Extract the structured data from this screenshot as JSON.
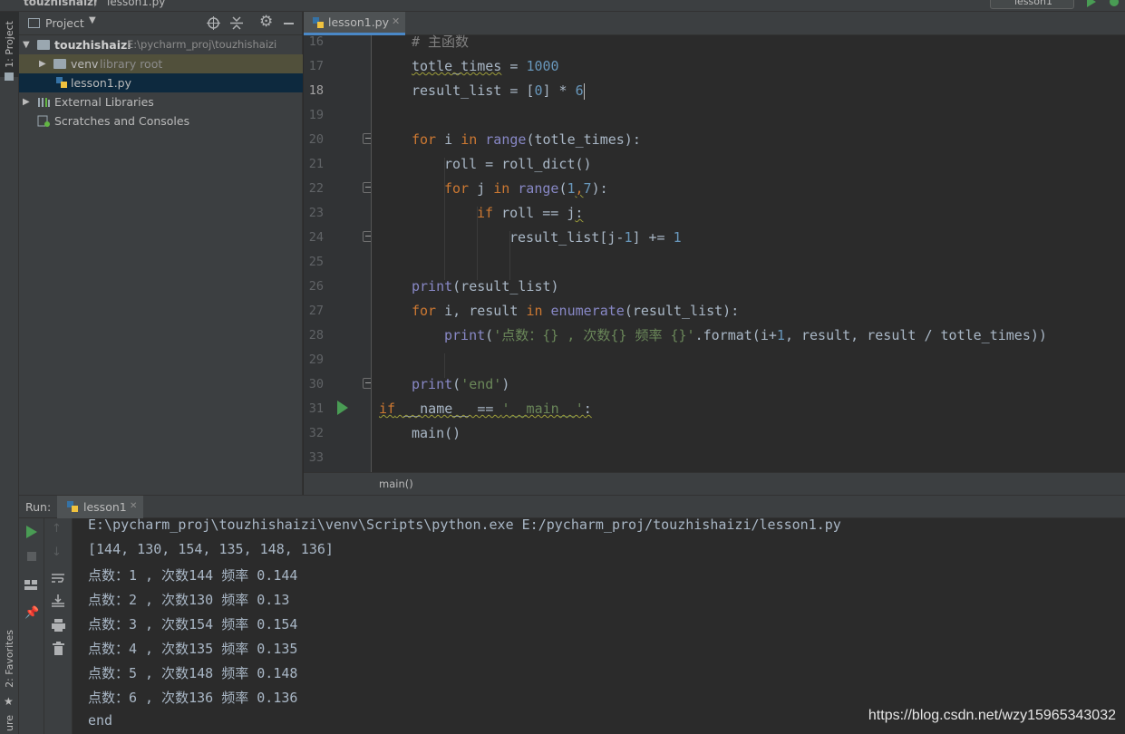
{
  "titlebar": {
    "project": "touzhishaizi",
    "file": "lesson1.py",
    "run_config": "lesson1"
  },
  "side_tabs": {
    "project": "1: Project",
    "favorites": "2: Favorites",
    "structure": "ure"
  },
  "project_panel": {
    "header": "Project",
    "tree": [
      {
        "label": "touzhishaizi",
        "extra": "E:\\pycharm_proj\\touzhishaizi",
        "icon": "folder-icon"
      },
      {
        "label": "venv",
        "extra": "library root",
        "icon": "folder-icon"
      },
      {
        "label": "lesson1.py",
        "extra": "",
        "icon": "python-file-icon"
      },
      {
        "label": "External Libraries",
        "extra": "",
        "icon": "library-icon"
      },
      {
        "label": "Scratches and Consoles",
        "extra": "",
        "icon": "scratches-icon"
      }
    ]
  },
  "editor": {
    "tab_label": "lesson1.py",
    "breadcrumb": "main()",
    "line_numbers": [
      "16",
      "17",
      "18",
      "19",
      "20",
      "21",
      "22",
      "23",
      "24",
      "25",
      "26",
      "27",
      "28",
      "29",
      "30",
      "31",
      "32",
      "33"
    ],
    "code": {
      "l16": "# 主函数",
      "l17a": "totle_times",
      "l17b": " = ",
      "l17c": "1000",
      "l18a": "result_list = [",
      "l18b": "0",
      "l18c": "] * ",
      "l18d": "6",
      "l20a": "for",
      "l20b": " i ",
      "l20c": "in",
      "l20d": " ",
      "l20e": "range",
      "l20f": "(totle_times):",
      "l21": "roll = roll_dict()",
      "l22a": "for",
      "l22b": " j ",
      "l22c": "in",
      "l22d": " ",
      "l22e": "range",
      "l22f": "(",
      "l22g": "1",
      "l22h": ",",
      "l22i": "7",
      "l22j": "):",
      "l23a": "if",
      "l23b": " roll == j",
      "l23c": ":",
      "l24a": "result_list[j-",
      "l24b": "1",
      "l24c": "] += ",
      "l24d": "1",
      "l26a": "print",
      "l26b": "(result_list)",
      "l27a": "for",
      "l27b": " i, result ",
      "l27c": "in",
      "l27d": " ",
      "l27e": "enumerate",
      "l27f": "(result_list):",
      "l28a": "print",
      "l28b": "(",
      "l28c": "'点数：{} , 次数{} 频率 {}'",
      "l28d": ".format(i+",
      "l28e": "1",
      "l28f": ", result, result / totle_times))",
      "l30a": "print",
      "l30b": "(",
      "l30c": "'end'",
      "l30d": ")",
      "l31a": "if",
      "l31b": " __name__ == ",
      "l31c": "'__main__'",
      "l31d": ":",
      "l32": "main()"
    }
  },
  "run_panel": {
    "label": "Run:",
    "tab_label": "lesson1",
    "output": [
      "E:\\pycharm_proj\\touzhishaizi\\venv\\Scripts\\python.exe E:/pycharm_proj/touzhishaizi/lesson1.py",
      "[144, 130, 154, 135, 148, 136]",
      "点数：1 , 次数144 频率 0.144",
      "点数：2 , 次数130 频率 0.13",
      "点数：3 , 次数154 频率 0.154",
      "点数：4 , 次数135 频率 0.135",
      "点数：5 , 次数148 频率 0.148",
      "点数：6 , 次数136 频率 0.136",
      "end"
    ]
  },
  "watermark": "https://blog.csdn.net/wzy15965343032",
  "colors": {
    "keyword": "#cc7832",
    "number": "#6897bb",
    "string": "#6a8759",
    "builtin": "#8888c6",
    "comment": "#808080",
    "text": "#a9b7c6",
    "selection": "#0d293e",
    "run_green": "#499c54"
  }
}
